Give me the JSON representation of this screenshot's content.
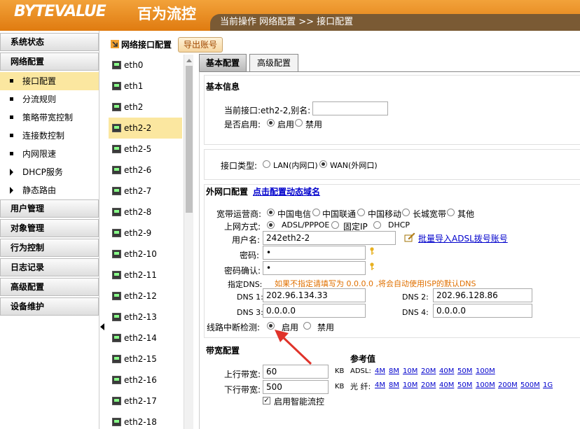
{
  "header": {
    "logo": "BYTEVALUE",
    "logo_cn": "百为流控",
    "breadcrumb": "当前操作  网络配置 >> 接口配置"
  },
  "nav": {
    "groups": [
      {
        "label": "系统状态"
      },
      {
        "label": "网络配置"
      }
    ],
    "subs": [
      {
        "label": "接口配置",
        "active": true,
        "marker": "bullet"
      },
      {
        "label": "分流规则",
        "marker": "bullet"
      },
      {
        "label": "策略带宽控制",
        "marker": "bullet"
      },
      {
        "label": "连接数控制",
        "marker": "bullet"
      },
      {
        "label": "内网限速",
        "marker": "bullet"
      },
      {
        "label": "DHCP服务",
        "marker": "triangle"
      },
      {
        "label": "静态路由",
        "marker": "triangle"
      }
    ],
    "groups2": [
      {
        "label": "用户管理"
      },
      {
        "label": "对象管理"
      },
      {
        "label": "行为控制"
      },
      {
        "label": "日志记录"
      },
      {
        "label": "高级配置"
      },
      {
        "label": "设备维护"
      }
    ]
  },
  "panel": {
    "title": "网络接口配置",
    "export_label": "导出账号"
  },
  "interfaces": [
    "eth0",
    "eth1",
    "eth2",
    "eth2-2",
    "eth2-5",
    "eth2-6",
    "eth2-7",
    "eth2-8",
    "eth2-9",
    "eth2-10",
    "eth2-11",
    "eth2-12",
    "eth2-13",
    "eth2-14",
    "eth2-15",
    "eth2-16",
    "eth2-17",
    "eth2-18"
  ],
  "selected_interface": "eth2-2",
  "tabs": {
    "basic": "基本配置",
    "advanced": "高级配置"
  },
  "basic": {
    "title": "基本信息",
    "current_label": "当前接口:eth2-2,别名:",
    "alias_value": "",
    "enable_label": "是否启用:",
    "opt_enable": "启用",
    "opt_disable": "禁用"
  },
  "iftype": {
    "label": "接口类型:",
    "opt_lan": "LAN(内网口)",
    "opt_wan": "WAN(外网口)",
    "selected": "WAN(外网口)"
  },
  "wan": {
    "title": "外网口配置",
    "dyn_link": "点击配置动态域名",
    "isp_label": "宽带运营商:",
    "isps": [
      "中国电信",
      "中国联通",
      "中国移动",
      "长城宽带",
      "其他"
    ],
    "isp_selected": "中国电信",
    "method_label": "上网方式:",
    "methods": [
      "ADSL/PPPOE",
      "固定IP",
      "DHCP"
    ],
    "method_selected": "ADSL/PPPOE",
    "user_label": "用户名:",
    "user_value": "242eth2-2",
    "batch_link": "批量导入ADSL拨号账号",
    "pwd_label": "密码:",
    "pwd_value": "•",
    "pwd2_label": "密码确认:",
    "pwd2_value": "•",
    "dns_label": "指定DNS:",
    "dns_hint": "如果不指定请填写为 0.0.0.0 ,将会自动使用ISP的默认DNS",
    "dns1_label": "DNS 1:",
    "dns1": "202.96.134.33",
    "dns2_label": "DNS 2:",
    "dns2": "202.96.128.86",
    "dns3_label": "DNS 3:",
    "dns3": "0.0.0.0",
    "dns4_label": "DNS 4:",
    "dns4": "0.0.0.0",
    "detect_label": "线路中断检测:",
    "detect_on": "启用",
    "detect_off": "禁用"
  },
  "bw": {
    "title": "带宽配置",
    "ref_title": "参考值",
    "up_label": "上行带宽:",
    "up_value": "60",
    "down_label": "下行带宽:",
    "down_value": "500",
    "unit": "KB",
    "adsl_label": "ADSL:",
    "adsl": [
      "4M",
      "8M",
      "10M",
      "20M",
      "40M",
      "50M",
      "100M"
    ],
    "fiber_label": "光  纤:",
    "fiber": [
      "4M",
      "8M",
      "10M",
      "20M",
      "40M",
      "50M",
      "100M",
      "200M",
      "500M",
      "1G"
    ],
    "smart_label": "启用智能流控"
  }
}
